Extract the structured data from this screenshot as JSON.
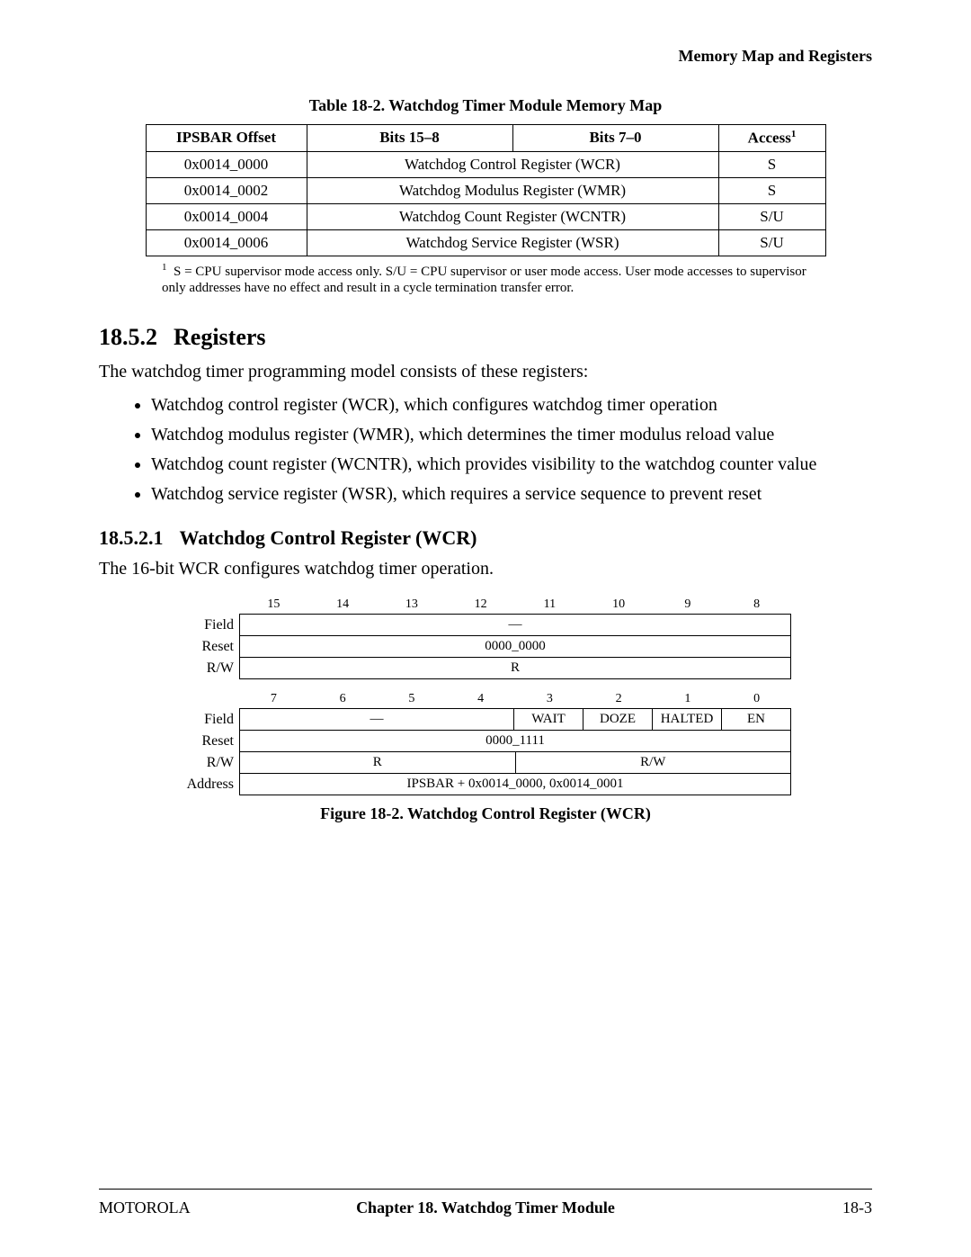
{
  "running_head": "Memory Map and Registers",
  "table_caption": "Table 18-2. Watchdog Timer Module Memory Map",
  "memmap": {
    "headers": {
      "offset": "IPSBAR Offset",
      "bits_hi": "Bits 15–8",
      "bits_lo": "Bits 7–0",
      "access": "Access",
      "access_fn": "1"
    },
    "rows": [
      {
        "offset": "0x0014_0000",
        "desc": "Watchdog Control Register (WCR)",
        "access": "S"
      },
      {
        "offset": "0x0014_0002",
        "desc": "Watchdog Modulus Register (WMR)",
        "access": "S"
      },
      {
        "offset": "0x0014_0004",
        "desc": "Watchdog Count Register (WCNTR)",
        "access": "S/U"
      },
      {
        "offset": "0x0014_0006",
        "desc": "Watchdog Service Register (WSR)",
        "access": "S/U"
      }
    ]
  },
  "footnote": {
    "marker": "1",
    "text": "S = CPU supervisor mode access only. S/U = CPU supervisor or user mode access. User mode accesses to supervisor only addresses have no effect and result in a cycle termination transfer error."
  },
  "sec": {
    "num": "18.5.2",
    "title": "Registers"
  },
  "intro": "The watchdog timer programming model consists of these registers:",
  "bullets": [
    "Watchdog control register (WCR), which configures watchdog timer operation",
    "Watchdog modulus register (WMR), which determines the timer modulus reload value",
    "Watchdog count register (WCNTR), which provides visibility to the watchdog counter value",
    "Watchdog service register (WSR), which requires a service sequence to prevent reset"
  ],
  "subsec": {
    "num": "18.5.2.1",
    "title": "Watchdog Control Register (WCR)"
  },
  "subsec_intro": "The 16-bit WCR configures watchdog timer operation.",
  "regfig": {
    "bitnums_hi": [
      "15",
      "14",
      "13",
      "12",
      "11",
      "10",
      "9",
      "8"
    ],
    "bitnums_lo": [
      "7",
      "6",
      "5",
      "4",
      "3",
      "2",
      "1",
      "0"
    ],
    "labels": {
      "field": "Field",
      "reset": "Reset",
      "rw": "R/W",
      "address": "Address"
    },
    "hi": {
      "field": "—",
      "reset": "0000_0000",
      "rw": "R"
    },
    "lo": {
      "field_reserved": "—",
      "field_bits": [
        "WAIT",
        "DOZE",
        "HALTED",
        "EN"
      ],
      "reset": "0000_1111",
      "rw_left": "R",
      "rw_right": "R/W"
    },
    "address": "IPSBAR + 0x0014_0000, 0x0014_0001"
  },
  "fig_caption": "Figure 18-2. Watchdog Control Register (WCR)",
  "footer": {
    "left": "MOTOROLA",
    "center": "Chapter 18.  Watchdog Timer Module",
    "right": "18-3"
  }
}
